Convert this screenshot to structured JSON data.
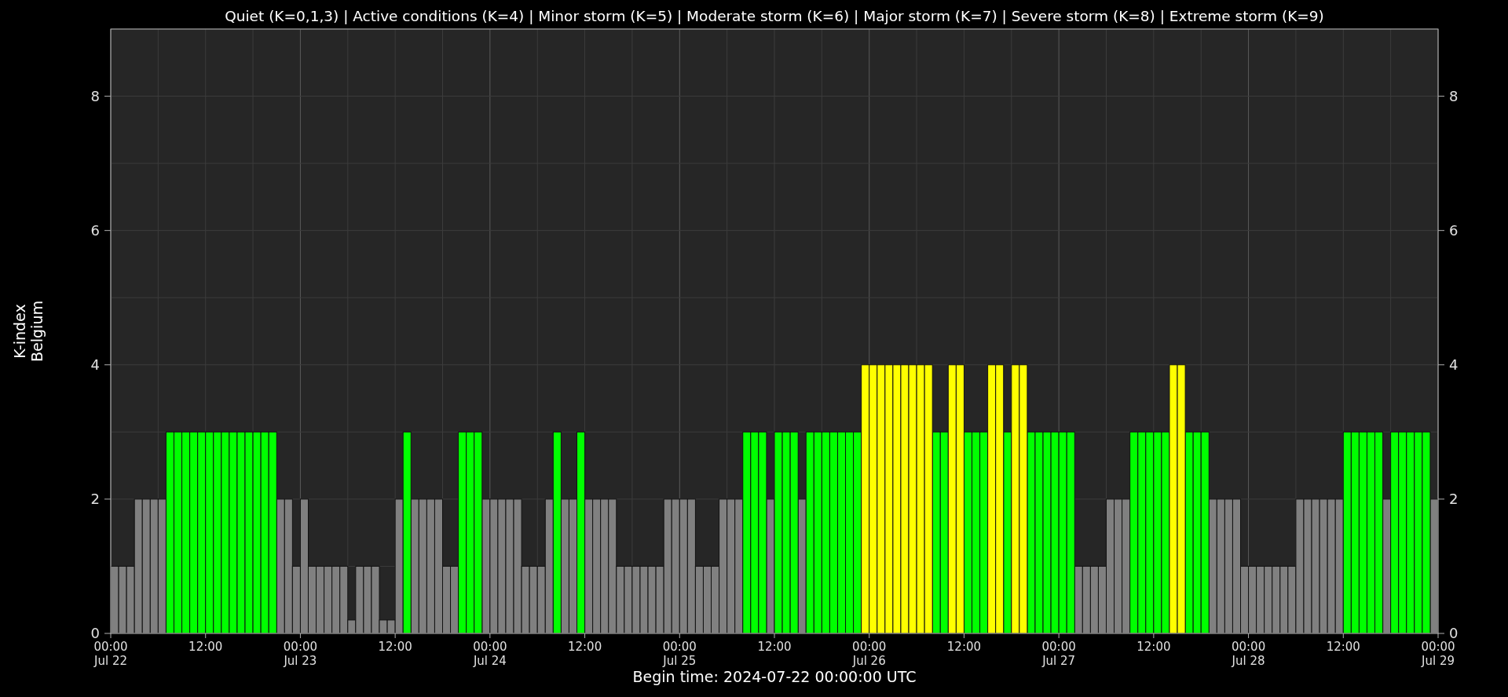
{
  "chart_data": {
    "type": "bar",
    "title": "Quiet (K=0,1,3) | Active conditions (K=4) | Minor storm (K=5) | Moderate storm (K=6) | Major storm (K=7) | Severe storm (K=8) | Extreme storm (K=9)",
    "xlabel": "Begin time: 2024-07-22 00:00:00 UTC",
    "ylabel": "K-index\nBelgium",
    "ylim": [
      0,
      9
    ],
    "grid": true,
    "yticks": [
      0,
      2,
      4,
      6,
      8
    ],
    "annotations": [
      "0",
      "2",
      "4",
      "6",
      "8"
    ],
    "categories": [
      "00:00\nJul 22",
      null,
      null,
      null,
      null,
      null,
      null,
      null,
      null,
      null,
      null,
      null,
      "12:00",
      null,
      null,
      null,
      null,
      null,
      null,
      null,
      null,
      null,
      null,
      null,
      "00:00\nJul 23",
      null,
      null,
      null,
      null,
      null,
      null,
      null,
      null,
      null,
      null,
      null,
      "12:00",
      null,
      null,
      null,
      null,
      null,
      null,
      null,
      null,
      null,
      null,
      null,
      "00:00\nJul 24",
      null,
      null,
      null,
      null,
      null,
      null,
      null,
      null,
      null,
      null,
      null,
      "12:00",
      null,
      null,
      null,
      null,
      null,
      null,
      null,
      null,
      null,
      null,
      null,
      "00:00\nJul 25",
      null,
      null,
      null,
      null,
      null,
      null,
      null,
      null,
      null,
      null,
      null,
      "12:00",
      null,
      null,
      null,
      null,
      null,
      null,
      null,
      null,
      null,
      null,
      null,
      "00:00\nJul 26",
      null,
      null,
      null,
      null,
      null,
      null,
      null,
      null,
      null,
      null,
      null,
      "12:00",
      null,
      null,
      null,
      null,
      null,
      null,
      null,
      null,
      null,
      null,
      null,
      "00:00\nJul 27",
      null,
      null,
      null,
      null,
      null,
      null,
      null,
      null,
      null,
      null,
      null,
      "12:00",
      null,
      null,
      null,
      null,
      null,
      null,
      null,
      null,
      null,
      null,
      null,
      "00:00\nJul 28",
      null,
      null,
      null,
      null,
      null,
      null,
      null,
      null,
      null,
      null,
      null,
      "12:00",
      null,
      null,
      null,
      null,
      null,
      null,
      null,
      null,
      null,
      null,
      null,
      "00:00\nJul 29"
    ],
    "series": [
      {
        "color": "#808080",
        "values": [
          1,
          1,
          1,
          2,
          2,
          2,
          2,
          null,
          null,
          null,
          null,
          null,
          null,
          null,
          null,
          null,
          null,
          null,
          null,
          null,
          null,
          2,
          2,
          1,
          2,
          1,
          1,
          1,
          1,
          1,
          0.2,
          1,
          1,
          1,
          0.2,
          0.2,
          2,
          null,
          2,
          2,
          2,
          2,
          1,
          1,
          null,
          null,
          null,
          2,
          2,
          2,
          2,
          2,
          1,
          1,
          1,
          2,
          null,
          2,
          2,
          null,
          2,
          2,
          2,
          2,
          1,
          1,
          1,
          1,
          1,
          1,
          2,
          2,
          2,
          2,
          1,
          1,
          1,
          2,
          2,
          2,
          null,
          null,
          null,
          2,
          null,
          null,
          null,
          2,
          null,
          null,
          null,
          null,
          null,
          null,
          null,
          null,
          null,
          null,
          null,
          null,
          null,
          null,
          null,
          null,
          null,
          null,
          null,
          null,
          null,
          null,
          null,
          null,
          null,
          null,
          null,
          null,
          null,
          null,
          null,
          null,
          null,
          null,
          1,
          1,
          1,
          1,
          2,
          2,
          2,
          null,
          null,
          null,
          null,
          null,
          null,
          null,
          null,
          null,
          null,
          2,
          2,
          2,
          2,
          1,
          1,
          1,
          1,
          1,
          1,
          1,
          2,
          2,
          2,
          2,
          2,
          2,
          null,
          null,
          null,
          null,
          null,
          2,
          null,
          null,
          null,
          null,
          null,
          2,
          null
        ]
      },
      {
        "color": "#00ff00",
        "values": [
          null,
          null,
          null,
          null,
          null,
          null,
          null,
          3,
          3,
          3,
          3,
          3,
          3,
          3,
          3,
          3,
          3,
          3,
          3,
          3,
          3,
          null,
          null,
          null,
          null,
          null,
          null,
          null,
          null,
          null,
          null,
          null,
          null,
          null,
          null,
          null,
          null,
          3,
          null,
          null,
          null,
          null,
          null,
          null,
          3,
          3,
          3,
          null,
          null,
          null,
          null,
          null,
          null,
          null,
          null,
          null,
          3,
          null,
          null,
          3,
          null,
          null,
          null,
          null,
          null,
          null,
          null,
          null,
          null,
          null,
          null,
          null,
          null,
          null,
          null,
          null,
          null,
          null,
          null,
          null,
          3,
          3,
          3,
          null,
          3,
          3,
          3,
          null,
          3,
          3,
          3,
          3,
          3,
          3,
          3,
          null,
          null,
          null,
          null,
          null,
          null,
          null,
          null,
          null,
          3,
          3,
          null,
          null,
          3,
          3,
          3,
          null,
          null,
          3,
          null,
          null,
          3,
          3,
          3,
          3,
          3,
          3,
          null,
          null,
          null,
          null,
          null,
          null,
          null,
          3,
          3,
          3,
          3,
          3,
          null,
          null,
          3,
          3,
          3,
          null,
          null,
          null,
          null,
          null,
          null,
          null,
          null,
          null,
          null,
          null,
          null,
          null,
          null,
          null,
          null,
          null,
          3,
          3,
          3,
          3,
          3,
          null,
          3,
          3,
          3,
          3,
          3,
          null,
          null
        ]
      },
      {
        "color": "#ffff00",
        "values": [
          null,
          null,
          null,
          null,
          null,
          null,
          null,
          null,
          null,
          null,
          null,
          null,
          null,
          null,
          null,
          null,
          null,
          null,
          null,
          null,
          null,
          null,
          null,
          null,
          null,
          null,
          null,
          null,
          null,
          null,
          null,
          null,
          null,
          null,
          null,
          null,
          null,
          null,
          null,
          null,
          null,
          null,
          null,
          null,
          null,
          null,
          null,
          null,
          null,
          null,
          null,
          null,
          null,
          null,
          null,
          null,
          null,
          null,
          null,
          null,
          null,
          null,
          null,
          null,
          null,
          null,
          null,
          null,
          null,
          null,
          null,
          null,
          null,
          null,
          null,
          null,
          null,
          null,
          null,
          null,
          null,
          null,
          null,
          null,
          null,
          null,
          null,
          null,
          null,
          null,
          null,
          null,
          null,
          null,
          null,
          4,
          4,
          4,
          4,
          4,
          4,
          4,
          4,
          4,
          null,
          null,
          4,
          4,
          null,
          null,
          null,
          4,
          4,
          null,
          4,
          4,
          null,
          null,
          null,
          null,
          null,
          null,
          null,
          null,
          null,
          null,
          null,
          null,
          null,
          null,
          null,
          null,
          null,
          null,
          4,
          4,
          null,
          null,
          null,
          null,
          null,
          null,
          null,
          null,
          null,
          null,
          null,
          null,
          null,
          null,
          null,
          null,
          null,
          null,
          null,
          null,
          null,
          null,
          null,
          null,
          null,
          null,
          null,
          null,
          null,
          null,
          null,
          null,
          null
        ]
      }
    ]
  }
}
